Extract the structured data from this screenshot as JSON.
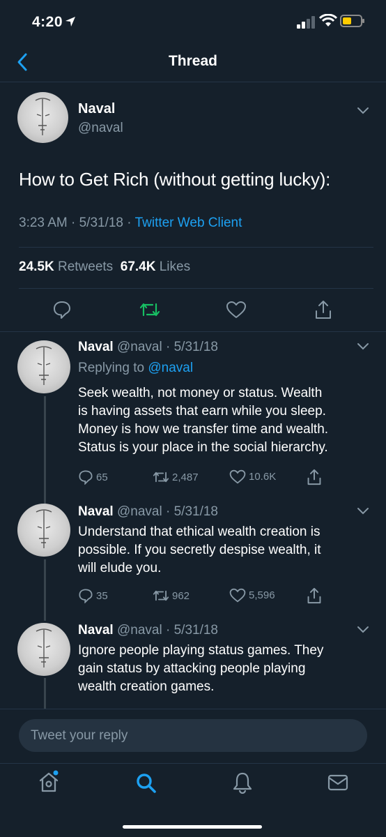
{
  "status_bar": {
    "time": "4:20"
  },
  "header": {
    "title": "Thread"
  },
  "main_tweet": {
    "name": "Naval",
    "handle": "@naval",
    "text": "How to Get Rich (without getting lucky):",
    "time": "3:23 AM",
    "date": "5/31/18",
    "client": "Twitter Web Client",
    "retweets": "24.5K",
    "retweets_label": "Retweets",
    "likes": "67.4K",
    "likes_label": "Likes"
  },
  "replies": [
    {
      "name": "Naval",
      "handle": "@naval",
      "date": "5/31/18",
      "replying_label": "Replying to",
      "replying_to": "@naval",
      "lines": [
        "Seek wealth, not money or status. Wealth",
        "is having assets that earn while you sleep.",
        "Money is how we transfer time and wealth.",
        "Status is your place in the social hierarchy."
      ],
      "replies": "65",
      "retweets": "2,487",
      "likes": "10.6K"
    },
    {
      "name": "Naval",
      "handle": "@naval",
      "date": "5/31/18",
      "lines": [
        "Understand that ethical wealth creation is",
        "possible. If you secretly despise wealth, it",
        "will elude you."
      ],
      "replies": "35",
      "retweets": "962",
      "likes": "5,596"
    },
    {
      "name": "Naval",
      "handle": "@naval",
      "date": "5/31/18",
      "lines": [
        "Ignore people playing status games. They",
        "gain status by attacking people playing",
        "wealth creation games."
      ]
    }
  ],
  "compose": {
    "placeholder": "Tweet your reply"
  },
  "colors": {
    "background": "#15202b",
    "accent": "#1da1f2",
    "retweet": "#17bf63",
    "muted": "#8899a6"
  },
  "icons": [
    "back-chevron-icon",
    "reply-icon",
    "retweet-icon",
    "like-icon",
    "share-icon",
    "home-icon",
    "search-icon",
    "notifications-icon",
    "messages-icon"
  ]
}
